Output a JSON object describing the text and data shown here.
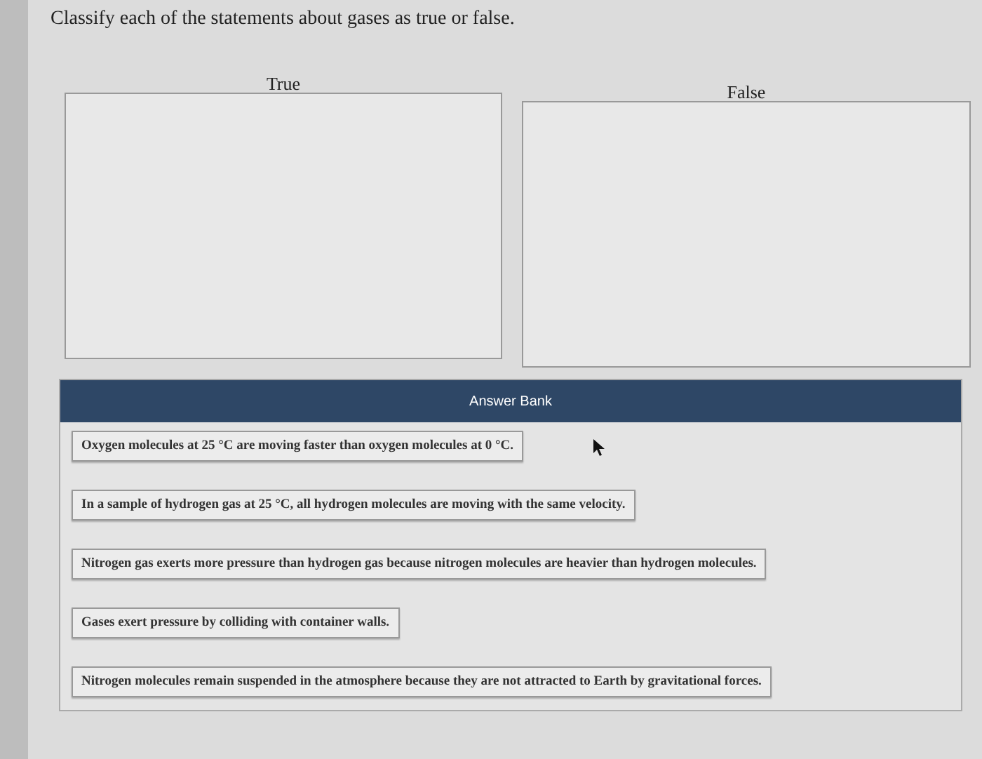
{
  "question": "Classify each of the statements about gases as true or false.",
  "bins": [
    {
      "label": "True"
    },
    {
      "label": "False"
    }
  ],
  "answer_bank": {
    "title": "Answer Bank",
    "items": [
      "Oxygen molecules at 25 °C are moving faster than oxygen molecules at 0 °C.",
      "In a sample of hydrogen gas at 25 °C, all hydrogen molecules are moving with the same velocity.",
      "Nitrogen gas exerts more pressure than hydrogen gas because nitrogen molecules are heavier than hydrogen molecules.",
      "Gases exert pressure by colliding with container walls.",
      "Nitrogen molecules remain suspended in the atmosphere because they are not attracted to Earth by gravitational forces."
    ]
  }
}
